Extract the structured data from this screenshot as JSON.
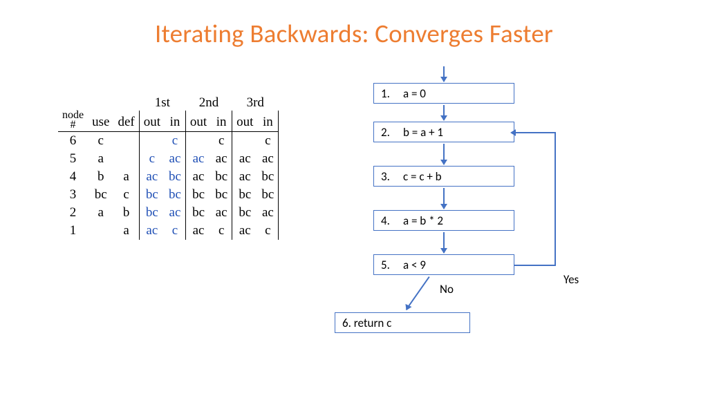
{
  "title": "Iterating Backwards: Converges Faster",
  "table": {
    "iter_headers": [
      "1st",
      "2nd",
      "3rd"
    ],
    "sub_node": "node\n#",
    "sub_use": "use",
    "sub_def": "def",
    "sub_out": "out",
    "sub_in": "in",
    "rows": [
      {
        "node": "6",
        "use": "c",
        "def": "",
        "i1_out": "",
        "i1_in": "c",
        "i1c": "blue",
        "i2_out": "",
        "i2_in": "c",
        "i3_out": "",
        "i3_in": "c"
      },
      {
        "node": "5",
        "use": "a",
        "def": "",
        "i1_out": "c",
        "i1_in": "ac",
        "i1c": "blue",
        "i2_out": "ac",
        "i2_in": "ac",
        "i2oc": "blue",
        "i3_out": "ac",
        "i3_in": "ac"
      },
      {
        "node": "4",
        "use": "b",
        "def": "a",
        "i1_out": "ac",
        "i1_in": "bc",
        "i1c": "blue",
        "i2_out": "ac",
        "i2_in": "bc",
        "i3_out": "ac",
        "i3_in": "bc"
      },
      {
        "node": "3",
        "use": "bc",
        "def": "c",
        "i1_out": "bc",
        "i1_in": "bc",
        "i1c": "blue",
        "i2_out": "bc",
        "i2_in": "bc",
        "i3_out": "bc",
        "i3_in": "bc"
      },
      {
        "node": "2",
        "use": "a",
        "def": "b",
        "i1_out": "bc",
        "i1_in": "ac",
        "i1c": "blue",
        "i2_out": "bc",
        "i2_in": "ac",
        "i3_out": "bc",
        "i3_in": "ac"
      },
      {
        "node": "1",
        "use": "",
        "def": "a",
        "i1_out": "ac",
        "i1_in": "c",
        "i1c": "blue",
        "i2_out": "ac",
        "i2_in": "c",
        "i3_out": "ac",
        "i3_in": "c"
      }
    ]
  },
  "flow": {
    "n1": "a = 0",
    "n2": "b = a + 1",
    "n3": "c = c + b",
    "n4": "a = b * 2",
    "n5": "a < 9",
    "n6": "6. return c",
    "num1": "1.",
    "num2": "2.",
    "num3": "3.",
    "num4": "4.",
    "num5": "5.",
    "yes": "Yes",
    "no": "No"
  }
}
